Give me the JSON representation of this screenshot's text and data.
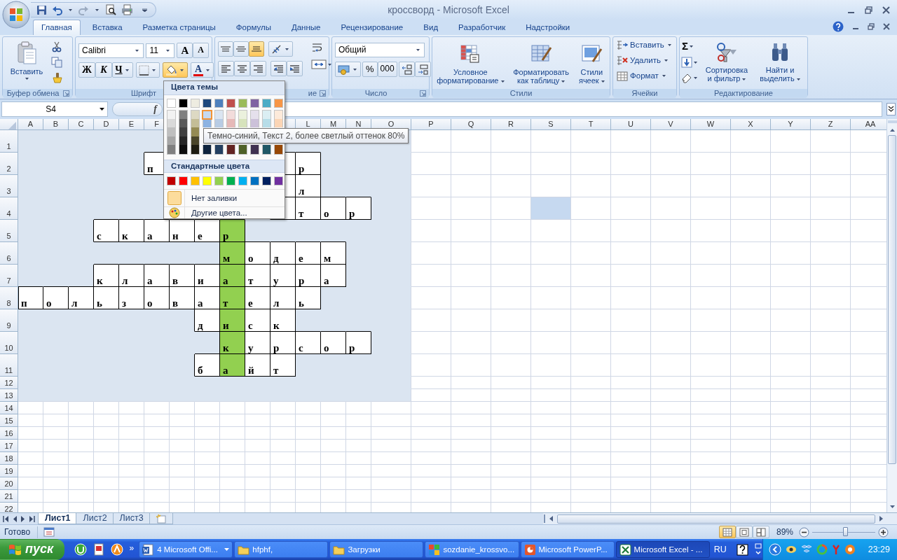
{
  "window": {
    "title": "кроссворд - Microsoft Excel"
  },
  "tabs": [
    {
      "label": "Главная",
      "selected": true
    },
    {
      "label": "Вставка",
      "selected": false
    },
    {
      "label": "Разметка страницы",
      "selected": false
    },
    {
      "label": "Формулы",
      "selected": false
    },
    {
      "label": "Данные",
      "selected": false
    },
    {
      "label": "Рецензирование",
      "selected": false
    },
    {
      "label": "Вид",
      "selected": false
    },
    {
      "label": "Разработчик",
      "selected": false
    },
    {
      "label": "Надстройки",
      "selected": false
    }
  ],
  "ribbon": {
    "clipboard": {
      "label": "Буфер обмена",
      "paste": "Вставить"
    },
    "font": {
      "label": "Шрифт",
      "font_name": "Calibri",
      "font_size": "11",
      "grow": "A",
      "shrink": "A",
      "bold": "Ж",
      "italic": "К",
      "underline": "Ч",
      "font_color": "A",
      "fill_open": true
    },
    "alignment": {
      "label": "ие",
      "vertical": [
        {
          "selected": false
        },
        {
          "selected": false
        },
        {
          "selected": true
        }
      ]
    },
    "number": {
      "label": "Число",
      "format": "Общий",
      "percent": "%",
      "thousands": "000"
    },
    "styles": {
      "label": "Стили",
      "buttons": [
        {
          "label": "Условное форматирование",
          "kind": "conditional"
        },
        {
          "label": "Форматировать как таблицу",
          "kind": "table"
        },
        {
          "label": "Стили ячеек",
          "kind": "styles"
        }
      ]
    },
    "cells": {
      "label": "Ячейки",
      "buttons": [
        {
          "label": "Вставить",
          "kind": "insert"
        },
        {
          "label": "Удалить",
          "kind": "delete"
        },
        {
          "label": "Формат",
          "kind": "format"
        }
      ]
    },
    "editing": {
      "label": "Редактирование",
      "sum": "Σ",
      "buttons": [
        {
          "label": "Сортировка и фильтр",
          "kind": "sort"
        },
        {
          "label": "Найти и выделить",
          "kind": "find"
        }
      ]
    }
  },
  "formula_bar": {
    "name_box": "S4",
    "function_label": "f"
  },
  "sheet": {
    "columns": [
      {
        "kind": "narrow",
        "label": "A"
      },
      {
        "kind": "narrow",
        "label": "B"
      },
      {
        "kind": "narrow",
        "label": "C"
      },
      {
        "kind": "narrow",
        "label": "D"
      },
      {
        "kind": "narrow",
        "label": "E"
      },
      {
        "kind": "narrow",
        "label": "F"
      },
      {
        "kind": "narrow"
      },
      {
        "kind": "narrow"
      },
      {
        "kind": "narrow"
      },
      {
        "kind": "narrow"
      },
      {
        "kind": "narrow"
      },
      {
        "kind": "narrow",
        "label": "L"
      },
      {
        "kind": "narrow",
        "label": "M"
      },
      {
        "kind": "narrow",
        "label": "N"
      },
      {
        "kind": "wide",
        "label": "O"
      },
      {
        "kind": "wide",
        "label": "P"
      },
      {
        "kind": "wide",
        "label": "Q"
      },
      {
        "kind": "wide",
        "label": "R"
      },
      {
        "kind": "wide",
        "label": "S"
      },
      {
        "kind": "wide",
        "label": "T"
      },
      {
        "kind": "wide",
        "label": "U"
      },
      {
        "kind": "wide",
        "label": "V"
      },
      {
        "kind": "wide",
        "label": "W"
      },
      {
        "kind": "wide",
        "label": "X"
      },
      {
        "kind": "wide",
        "label": "Y"
      },
      {
        "kind": "wide",
        "label": "Z"
      },
      {
        "kind": "wide",
        "label": "AA"
      }
    ],
    "rows": [
      {
        "label": "1",
        "kind": "tall",
        "cells": [
          {
            "kind": "fill"
          },
          {
            "kind": "fill"
          },
          {
            "kind": "fill"
          },
          {
            "kind": "fill"
          },
          {
            "kind": "fill"
          },
          {
            "kind": "fill"
          },
          {
            "kind": "fill"
          },
          {
            "kind": "fill"
          },
          {
            "kind": "fill"
          },
          {
            "kind": "fill"
          },
          {
            "kind": "fill"
          },
          {
            "kind": "fill"
          },
          {
            "kind": "fill"
          },
          {
            "kind": "fill"
          },
          {
            "kind": "fill"
          }
        ]
      },
      {
        "label": "2",
        "kind": "tall",
        "cells": [
          {
            "kind": "fill"
          },
          {
            "kind": "fill"
          },
          {
            "kind": "fill"
          },
          {
            "kind": "fill"
          },
          {
            "kind": "fill"
          },
          {
            "kind": "box",
            "text": "п"
          },
          {
            "kind": "box"
          },
          {
            "kind": "box"
          },
          {
            "kind": "box"
          },
          {
            "kind": "box"
          },
          {
            "kind": "box"
          },
          {
            "kind": "box",
            "text": "р"
          },
          {
            "kind": "fill"
          },
          {
            "kind": "fill"
          },
          {
            "kind": "fill"
          }
        ]
      },
      {
        "label": "3",
        "kind": "tall",
        "cells": [
          {
            "kind": "fill"
          },
          {
            "kind": "fill"
          },
          {
            "kind": "fill"
          },
          {
            "kind": "fill"
          },
          {
            "kind": "fill"
          },
          {
            "kind": "fill"
          },
          {
            "kind": "fill"
          },
          {
            "kind": "fill"
          },
          {
            "kind": "fill"
          },
          {
            "kind": "fill"
          },
          {
            "kind": "box"
          },
          {
            "kind": "box",
            "text": "л"
          },
          {
            "kind": "fill"
          },
          {
            "kind": "fill"
          },
          {
            "kind": "fill"
          }
        ]
      },
      {
        "label": "4",
        "kind": "tall",
        "cells": [
          {
            "kind": "fill"
          },
          {
            "kind": "fill"
          },
          {
            "kind": "fill"
          },
          {
            "kind": "fill"
          },
          {
            "kind": "fill"
          },
          {
            "kind": "fill"
          },
          {
            "kind": "fill"
          },
          {
            "kind": "fill"
          },
          {
            "kind": "fill"
          },
          {
            "kind": "fill"
          },
          {
            "kind": "box"
          },
          {
            "kind": "box",
            "text": "т"
          },
          {
            "kind": "box",
            "text": "о"
          },
          {
            "kind": "box",
            "text": "р"
          },
          {
            "kind": "fill"
          },
          {
            "kind": "plain"
          },
          {
            "kind": "plain"
          },
          {
            "kind": "plain"
          },
          {
            "kind": "preview"
          }
        ]
      },
      {
        "label": "5",
        "kind": "tall",
        "cells": [
          {
            "kind": "fill"
          },
          {
            "kind": "fill"
          },
          {
            "kind": "fill"
          },
          {
            "kind": "box",
            "text": "с"
          },
          {
            "kind": "box",
            "text": "к"
          },
          {
            "kind": "box",
            "text": "а"
          },
          {
            "kind": "box",
            "text": "н"
          },
          {
            "kind": "box",
            "text": "е"
          },
          {
            "kind": "accent",
            "text": "р"
          },
          {
            "kind": "fill"
          },
          {
            "kind": "fill"
          },
          {
            "kind": "fill"
          },
          {
            "kind": "fill"
          },
          {
            "kind": "fill"
          },
          {
            "kind": "fill"
          }
        ]
      },
      {
        "label": "6",
        "kind": "tall",
        "cells": [
          {
            "kind": "fill"
          },
          {
            "kind": "fill"
          },
          {
            "kind": "fill"
          },
          {
            "kind": "fill"
          },
          {
            "kind": "fill"
          },
          {
            "kind": "fill"
          },
          {
            "kind": "fill"
          },
          {
            "kind": "fill"
          },
          {
            "kind": "accent",
            "text": "м"
          },
          {
            "kind": "box",
            "text": "о"
          },
          {
            "kind": "box",
            "text": "д"
          },
          {
            "kind": "box",
            "text": "е"
          },
          {
            "kind": "box",
            "text": "м"
          },
          {
            "kind": "fill"
          },
          {
            "kind": "fill"
          }
        ]
      },
      {
        "label": "7",
        "kind": "tall",
        "cells": [
          {
            "kind": "fill"
          },
          {
            "kind": "fill"
          },
          {
            "kind": "fill"
          },
          {
            "kind": "box",
            "text": "к"
          },
          {
            "kind": "box",
            "text": "л"
          },
          {
            "kind": "box",
            "text": "а"
          },
          {
            "kind": "box",
            "text": "в"
          },
          {
            "kind": "box",
            "text": "и"
          },
          {
            "kind": "accent",
            "text": "а"
          },
          {
            "kind": "box",
            "text": "т"
          },
          {
            "kind": "box",
            "text": "у"
          },
          {
            "kind": "box",
            "text": "р"
          },
          {
            "kind": "box",
            "text": "а"
          },
          {
            "kind": "fill"
          },
          {
            "kind": "fill"
          }
        ]
      },
      {
        "label": "8",
        "kind": "tall",
        "cells": [
          {
            "kind": "box",
            "text": "п"
          },
          {
            "kind": "box",
            "text": "о"
          },
          {
            "kind": "box",
            "text": "л"
          },
          {
            "kind": "box",
            "text": "ь"
          },
          {
            "kind": "box",
            "text": "з"
          },
          {
            "kind": "box",
            "text": "о"
          },
          {
            "kind": "box",
            "text": "в"
          },
          {
            "kind": "box",
            "text": "а"
          },
          {
            "kind": "accent",
            "text": "т"
          },
          {
            "kind": "box",
            "text": "е"
          },
          {
            "kind": "box",
            "text": "л"
          },
          {
            "kind": "box",
            "text": "ь"
          },
          {
            "kind": "fill"
          },
          {
            "kind": "fill"
          },
          {
            "kind": "fill"
          }
        ]
      },
      {
        "label": "9",
        "kind": "tall",
        "cells": [
          {
            "kind": "fill"
          },
          {
            "kind": "fill"
          },
          {
            "kind": "fill"
          },
          {
            "kind": "fill"
          },
          {
            "kind": "fill"
          },
          {
            "kind": "fill"
          },
          {
            "kind": "fill"
          },
          {
            "kind": "box",
            "text": "д"
          },
          {
            "kind": "accent",
            "text": "и"
          },
          {
            "kind": "box",
            "text": "с"
          },
          {
            "kind": "box",
            "text": "к"
          },
          {
            "kind": "fill"
          },
          {
            "kind": "fill"
          },
          {
            "kind": "fill"
          },
          {
            "kind": "fill"
          }
        ]
      },
      {
        "label": "10",
        "kind": "tall",
        "cells": [
          {
            "kind": "fill"
          },
          {
            "kind": "fill"
          },
          {
            "kind": "fill"
          },
          {
            "kind": "fill"
          },
          {
            "kind": "fill"
          },
          {
            "kind": "fill"
          },
          {
            "kind": "fill"
          },
          {
            "kind": "fill"
          },
          {
            "kind": "accent",
            "text": "к"
          },
          {
            "kind": "box",
            "text": "у"
          },
          {
            "kind": "box",
            "text": "р"
          },
          {
            "kind": "box",
            "text": "с"
          },
          {
            "kind": "box",
            "text": "о"
          },
          {
            "kind": "box",
            "text": "р"
          },
          {
            "kind": "fill"
          }
        ]
      },
      {
        "label": "11",
        "kind": "tall",
        "cells": [
          {
            "kind": "fill"
          },
          {
            "kind": "fill"
          },
          {
            "kind": "fill"
          },
          {
            "kind": "fill"
          },
          {
            "kind": "fill"
          },
          {
            "kind": "fill"
          },
          {
            "kind": "fill"
          },
          {
            "kind": "box",
            "text": "б"
          },
          {
            "kind": "accent",
            "text": "а"
          },
          {
            "kind": "box",
            "text": "й"
          },
          {
            "kind": "box",
            "text": "т"
          },
          {
            "kind": "fill"
          },
          {
            "kind": "fill"
          },
          {
            "kind": "fill"
          },
          {
            "kind": "fill"
          }
        ]
      },
      {
        "label": "12",
        "kind": "short",
        "cells": [
          {
            "kind": "fill"
          },
          {
            "kind": "fill"
          },
          {
            "kind": "fill"
          },
          {
            "kind": "fill"
          },
          {
            "kind": "fill"
          },
          {
            "kind": "fill"
          },
          {
            "kind": "fill"
          },
          {
            "kind": "fill"
          },
          {
            "kind": "fill"
          },
          {
            "kind": "fill"
          },
          {
            "kind": "fill"
          },
          {
            "kind": "fill"
          },
          {
            "kind": "fill"
          },
          {
            "kind": "fill"
          },
          {
            "kind": "fill"
          }
        ]
      },
      {
        "label": "13",
        "kind": "short",
        "cells": [
          {
            "kind": "fill"
          },
          {
            "kind": "fill"
          },
          {
            "kind": "fill"
          },
          {
            "kind": "fill"
          },
          {
            "kind": "fill"
          },
          {
            "kind": "fill"
          },
          {
            "kind": "fill"
          },
          {
            "kind": "fill"
          },
          {
            "kind": "fill"
          },
          {
            "kind": "fill"
          },
          {
            "kind": "fill"
          },
          {
            "kind": "fill"
          },
          {
            "kind": "fill"
          },
          {
            "kind": "fill"
          },
          {
            "kind": "fill"
          }
        ]
      },
      {
        "label": "14",
        "kind": "short"
      },
      {
        "label": "15",
        "kind": "short"
      },
      {
        "label": "16",
        "kind": "short"
      },
      {
        "label": "17",
        "kind": "short"
      },
      {
        "label": "18",
        "kind": "short"
      },
      {
        "label": "19",
        "kind": "short"
      },
      {
        "label": "20",
        "kind": "short"
      },
      {
        "label": "21",
        "kind": "short"
      },
      {
        "label": "22",
        "kind": "short"
      }
    ]
  },
  "fill_menu": {
    "header": "Цвета темы",
    "theme_colors": [
      {
        "color": "#ffffff",
        "shades": [
          {
            "color": "#f2f2f2",
            "hovered": false
          },
          {
            "color": "#d9d9d9",
            "hovered": false
          },
          {
            "color": "#bfbfbf",
            "hovered": false
          },
          {
            "color": "#a6a6a6",
            "hovered": false
          },
          {
            "color": "#808080",
            "hovered": false
          }
        ]
      },
      {
        "color": "#000000",
        "shades": [
          {
            "color": "#808080",
            "hovered": false
          },
          {
            "color": "#595959",
            "hovered": false
          },
          {
            "color": "#404040",
            "hovered": false
          },
          {
            "color": "#262626",
            "hovered": false
          },
          {
            "color": "#0d0d0d",
            "hovered": false
          }
        ]
      },
      {
        "color": "#eeece1",
        "shades": [
          {
            "color": "#ddd9c3",
            "hovered": false
          },
          {
            "color": "#c4bd97",
            "hovered": false
          },
          {
            "color": "#948a54",
            "hovered": false
          },
          {
            "color": "#4a452a",
            "hovered": false
          },
          {
            "color": "#1e1c11",
            "hovered": false
          }
        ]
      },
      {
        "color": "#1f497d",
        "shades": [
          {
            "color": "#c6d9f0",
            "hovered": true
          },
          {
            "color": "#8db3e2",
            "hovered": false
          },
          {
            "color": "#0f243e",
            "hovered": false
          }
        ]
      },
      {
        "color": "#4f81bd",
        "shades": [
          {
            "color": "#dbe5f1",
            "hovered": false
          },
          {
            "color": "#b8cce4",
            "hovered": false
          },
          {
            "color": "#244061",
            "hovered": false
          }
        ]
      },
      {
        "color": "#c0504d",
        "shades": [
          {
            "color": "#f2dcdb",
            "hovered": false
          },
          {
            "color": "#e6b9b8",
            "hovered": false
          },
          {
            "color": "#632423",
            "hovered": false
          }
        ]
      },
      {
        "color": "#9bbb59",
        "shades": [
          {
            "color": "#ebf1dd",
            "hovered": false
          },
          {
            "color": "#d7e3bc",
            "hovered": false
          },
          {
            "color": "#4f6128",
            "hovered": false
          }
        ]
      },
      {
        "color": "#8064a2",
        "shades": [
          {
            "color": "#e5e0ec",
            "hovered": false
          },
          {
            "color": "#ccc1d9",
            "hovered": false
          },
          {
            "color": "#3f3151",
            "hovered": false
          }
        ]
      },
      {
        "color": "#4bacc6",
        "shades": [
          {
            "color": "#dbeef3",
            "hovered": false
          },
          {
            "color": "#b7dde8",
            "hovered": false
          },
          {
            "color": "#205867",
            "hovered": false
          }
        ]
      },
      {
        "color": "#f79646",
        "shades": [
          {
            "color": "#fdeada",
            "hovered": false
          },
          {
            "color": "#fbd5b5",
            "hovered": false
          },
          {
            "color": "#974806",
            "hovered": false
          }
        ]
      }
    ],
    "standard_header": "Стандартные цвета",
    "standard_colors": [
      {
        "color": "#c00000"
      },
      {
        "color": "#ff0000"
      },
      {
        "color": "#ffc000"
      },
      {
        "color": "#ffff00"
      },
      {
        "color": "#92d050"
      },
      {
        "color": "#00b050"
      },
      {
        "color": "#00b0f0"
      },
      {
        "color": "#0070c0"
      },
      {
        "color": "#002060"
      },
      {
        "color": "#7030a0"
      }
    ],
    "no_fill": "Нет заливки",
    "more_colors": "Другие цвета...",
    "tooltip": "Темно-синий, Текст 2, более светлый оттенок 80%"
  },
  "sheet_tabs": [
    {
      "label": "Лист1",
      "selected": true
    },
    {
      "label": "Лист2",
      "selected": false
    },
    {
      "label": "Лист3",
      "selected": false
    }
  ],
  "status_bar": {
    "status": "Готово",
    "views": [
      {
        "selected": true
      },
      {
        "selected": false
      },
      {
        "selected": false
      }
    ],
    "zoom": "89%",
    "zoom_slider": {
      "level": 0.52
    }
  },
  "taskbar": {
    "start": "пуск",
    "quick_launch_more": "»",
    "tasks": [
      {
        "label": "4 Microsoft Offi...",
        "kind": "word",
        "selected": false
      },
      {
        "label": "hfphf,",
        "kind": "folder",
        "selected": false
      },
      {
        "label": "Загрузки",
        "kind": "folder",
        "selected": false
      },
      {
        "label": "sozdanie_krossvo...",
        "kind": "image",
        "selected": false
      },
      {
        "label": "Microsoft PowerP...",
        "kind": "powerpoint",
        "selected": false
      },
      {
        "label": "Microsoft Excel - ...",
        "kind": "excel",
        "selected": true
      }
    ],
    "language": "RU",
    "clock": "23:29"
  }
}
